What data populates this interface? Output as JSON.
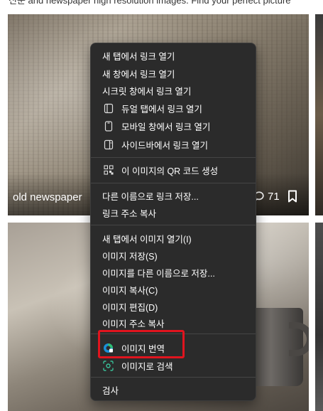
{
  "page": {
    "header_text": "신문 and newspaper high resolution images. Find your perfect picture"
  },
  "cards": [
    {
      "caption": "old newspaper",
      "comment_count": "71"
    }
  ],
  "context_menu": {
    "items": [
      {
        "label": "새 탭에서 링크 열기",
        "icon": ""
      },
      {
        "label": "새 창에서 링크 열기",
        "icon": ""
      },
      {
        "label": "시크릿 창에서 링크 열기",
        "icon": ""
      },
      {
        "label": "듀얼 탭에서 링크 열기",
        "icon": "dual-tab-icon"
      },
      {
        "label": "모바일 창에서 링크 열기",
        "icon": "mobile-window-icon"
      },
      {
        "label": "사이드바에서 링크 열기",
        "icon": "sidebar-icon"
      },
      {
        "label": "이 이미지의 QR 코드 생성",
        "icon": "qr-code-icon"
      },
      {
        "label": "다른 이름으로 링크 저장...",
        "icon": ""
      },
      {
        "label": "링크 주소 복사",
        "icon": ""
      },
      {
        "label": "새 탭에서 이미지 열기(I)",
        "icon": ""
      },
      {
        "label": "이미지 저장(S)",
        "icon": ""
      },
      {
        "label": "이미지를 다른 이름으로 저장...",
        "icon": ""
      },
      {
        "label": "이미지 복사(C)",
        "icon": ""
      },
      {
        "label": "이미지 편집(D)",
        "icon": ""
      },
      {
        "label": "이미지 주소 복사",
        "icon": ""
      },
      {
        "label": "이미지 번역",
        "icon": "translate-icon"
      },
      {
        "label": "이미지로 검색",
        "icon": "visual-search-icon"
      },
      {
        "label": "검사",
        "icon": ""
      }
    ]
  },
  "colors": {
    "menu_bg": "#2b2b2b",
    "highlight": "#e0141e",
    "search_icon": "#39c29a"
  }
}
